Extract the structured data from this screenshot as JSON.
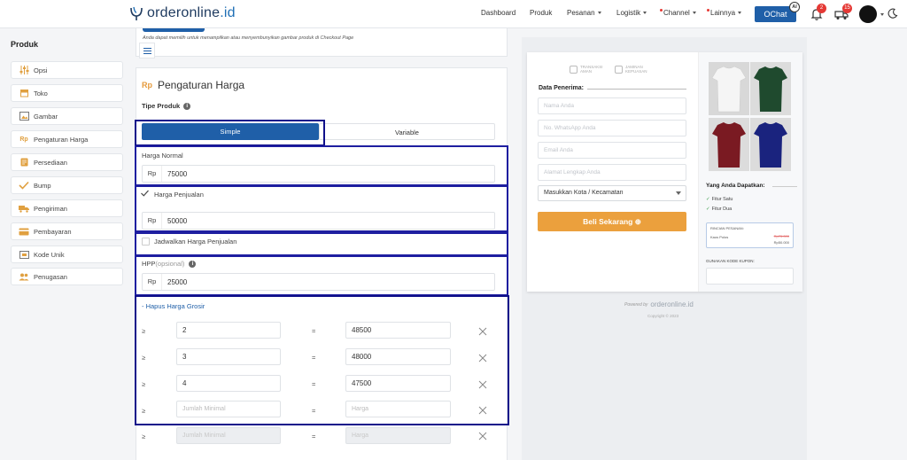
{
  "brand": {
    "logo_text_a": "orderonline",
    "logo_text_b": ".id"
  },
  "nav": {
    "items": [
      {
        "label": "Dashboard",
        "caret": false,
        "dot": false
      },
      {
        "label": "Produk",
        "caret": false,
        "dot": false
      },
      {
        "label": "Pesanan",
        "caret": true,
        "dot": false
      },
      {
        "label": "Logistik",
        "caret": true,
        "dot": false
      },
      {
        "label": "Channel",
        "caret": true,
        "dot": true
      },
      {
        "label": "Lainnya",
        "caret": true,
        "dot": true
      }
    ],
    "ochat_label": "OChat",
    "ai_badge": "AI",
    "bell_count": "2",
    "truck_count": "15"
  },
  "sidebar": {
    "title": "Produk",
    "items": [
      {
        "label": "Opsi",
        "icon": "sliders-icon"
      },
      {
        "label": "Toko",
        "icon": "store-icon"
      },
      {
        "label": "Gambar",
        "icon": "image-icon"
      },
      {
        "label": "Pengaturan Harga",
        "icon": "rp-icon"
      },
      {
        "label": "Persediaan",
        "icon": "inventory-icon"
      },
      {
        "label": "Bump",
        "icon": "check-icon"
      },
      {
        "label": "Pengiriman",
        "icon": "truck-icon"
      },
      {
        "label": "Pembayaran",
        "icon": "card-icon"
      },
      {
        "label": "Kode Unik",
        "icon": "code-icon"
      },
      {
        "label": "Penugasan",
        "icon": "users-icon"
      }
    ]
  },
  "main": {
    "image_note": "Anda dapat memilih untuk menampilkan atau menyembunyikan gambar produk di Checkout Page",
    "section_icon": "Rp",
    "section_title": "Pengaturan Harga",
    "tipe_produk_label": "Tipe Produk",
    "tabs": {
      "simple": "Simple",
      "variable": "Variable"
    },
    "harga_normal": {
      "label": "Harga Normal",
      "prefix": "Rp",
      "value": "75000"
    },
    "harga_penjualan": {
      "label": "Harga Penjualan",
      "prefix": "Rp",
      "value": "50000",
      "checked": true
    },
    "jadwalkan_label": "Jadwalkan Harga Penjualan",
    "hpp": {
      "label": "HPP",
      "optional": "(opsional)",
      "prefix": "Rp",
      "value": "25000"
    },
    "hapus_grosir": "-  Hapus Harga Grosir",
    "tier_ge": "≥",
    "tier_eq": "=",
    "tiers": [
      {
        "min": "2",
        "price": "48500"
      },
      {
        "min": "3",
        "price": "48000"
      },
      {
        "min": "4",
        "price": "47500"
      }
    ],
    "tier_placeholder_min": "Jumlah Minimal",
    "tier_placeholder_price": "Harga"
  },
  "preview": {
    "trust_1": [
      "TRANSAKSI",
      "AMAN"
    ],
    "trust_2": [
      "JAMINAN",
      "KEPUASAN"
    ],
    "data_penerima": "Data Penerima:",
    "placeholders": [
      "Nama Anda",
      "No. WhatsApp Anda",
      "Email Anda",
      "Alamat Lengkap Anda"
    ],
    "kota_select": "Masukkan Kota / Kecamatan",
    "beli_label": "Beli Sekarang ⊕",
    "yang_anda": "Yang Anda Dapatkan:",
    "fitur": [
      "Fitur Satu",
      "Fitur Dua"
    ],
    "rincian_title": "RINCIAN PESANAN:",
    "rincian_item": "Kaos Polos",
    "rincian_old": "Rp75.000",
    "rincian_new": "Rp50.000",
    "kupon_label": "GUNAKAN KODE KUPON:",
    "powered_by": "Powered by",
    "powered_logo": "orderonline.id",
    "copyright": "Copyright © 2023",
    "shirt_colors": [
      "#f2f2f2",
      "#1f4a2e",
      "#7a1a22",
      "#1a237e"
    ]
  },
  "colors": {
    "primary": "#1f5fa8",
    "accent": "#eba03d",
    "highlight": "#1e1ea0"
  }
}
